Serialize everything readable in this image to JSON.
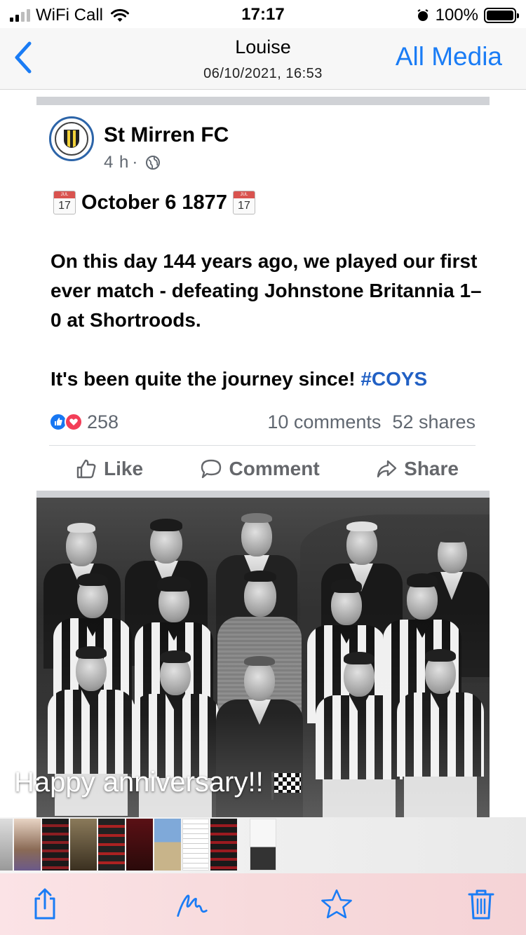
{
  "status_bar": {
    "carrier": "WiFi Call",
    "time": "17:17",
    "battery": "100%",
    "signal_bars_filled": 2,
    "signal_bars_total": 4
  },
  "nav": {
    "title": "Louise",
    "subtitle": "06/10/2021, 16:53",
    "right_action": "All Media"
  },
  "post": {
    "page_name": "St Mirren FC",
    "time_ago": "4 h",
    "time_separator": "·",
    "date_headline": "October 6 1877",
    "calendar_day": "17",
    "calendar_month": "JUL",
    "paragraph_1": "On this day 144 years ago, we played our first ever match - defeating Johnstone Britannia 1–0 at Shortroods.",
    "paragraph_2_text": "It's been quite the journey since! ",
    "hashtag": "#COYS",
    "reaction_count": "258",
    "comments": "10 comments",
    "shares": "52 shares",
    "actions": {
      "like": "Like",
      "comment": "Comment",
      "share": "Share"
    }
  },
  "caption": "Happy anniversary!!",
  "colors": {
    "ios_blue": "#1a7cf5",
    "hashtag_blue": "#2160c4",
    "fb_like_blue": "#1877f2",
    "fb_love_red": "#f33e58",
    "toolbar_tint": "#f7dadc"
  },
  "icons": {
    "back": "chevron-left-icon",
    "share": "share-icon",
    "markup": "markup-icon",
    "favorite": "star-icon",
    "delete": "trash-icon"
  }
}
